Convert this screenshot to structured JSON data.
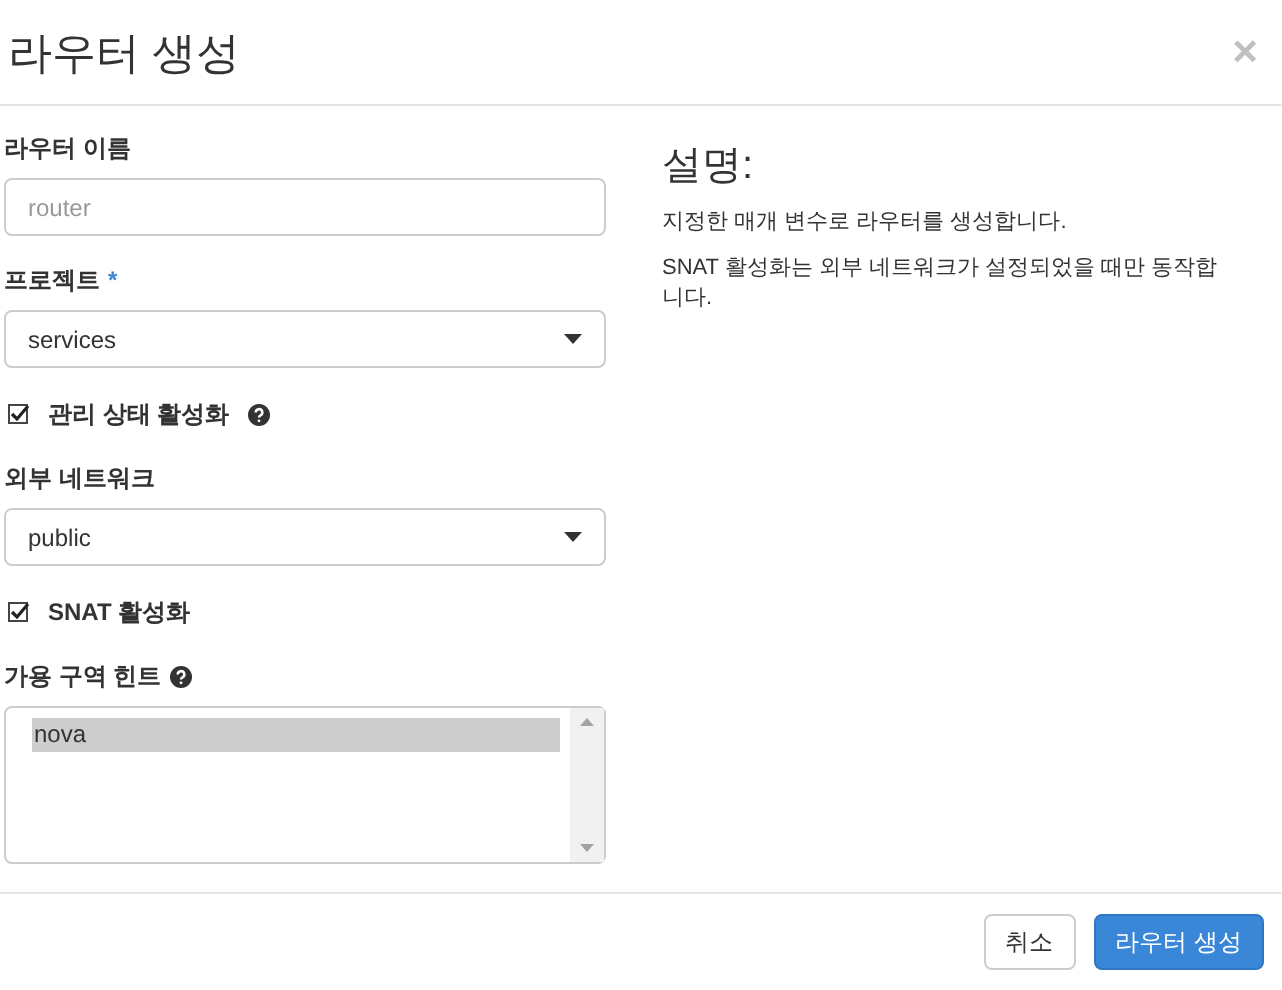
{
  "dialog": {
    "title": "라우터 생성",
    "close": "×"
  },
  "form": {
    "name_field": {
      "label": "라우터 이름",
      "placeholder": "router"
    },
    "project": {
      "label": "프로젝트",
      "required_mark": "*",
      "value": "services"
    },
    "admin_state": {
      "label": "관리 상태 활성화",
      "checked": true
    },
    "external_network": {
      "label": "외부 네트워크",
      "value": "public"
    },
    "snat": {
      "label": "SNAT 활성화",
      "checked": true
    },
    "availability_zone": {
      "label": "가용 구역 힌트",
      "options": [
        {
          "label": "nova",
          "selected": true
        }
      ]
    }
  },
  "description": {
    "heading": "설명:",
    "paragraphs": [
      "지정한 매개 변수로 라우터를 생성합니다.",
      "SNAT 활성화는 외부 네트워크가 설정되었을 때만 동작합니다."
    ]
  },
  "buttons": [
    {
      "label": "취소",
      "kind": "default"
    },
    {
      "label": "라우터 생성",
      "kind": "primary"
    }
  ]
}
